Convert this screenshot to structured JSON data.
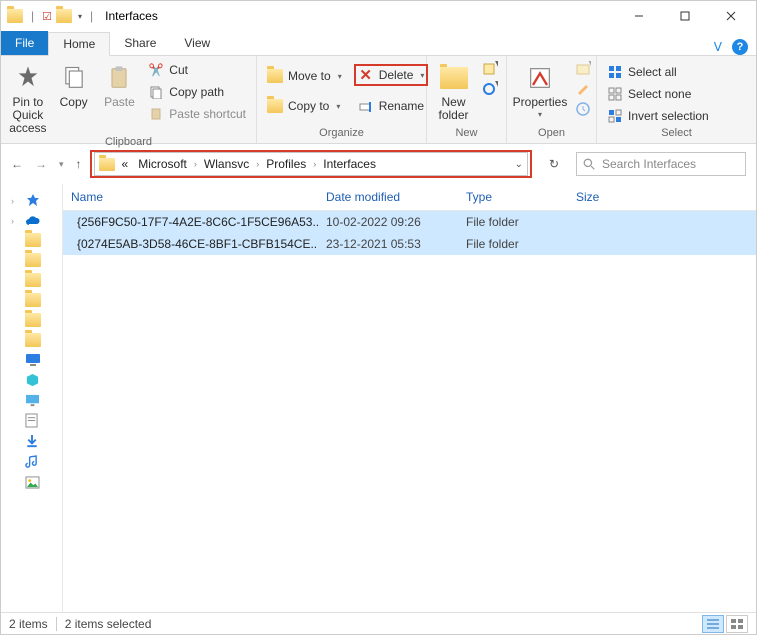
{
  "window": {
    "title": "Interfaces"
  },
  "tabs": {
    "file": "File",
    "home": "Home",
    "share": "Share",
    "view": "View"
  },
  "ribbon": {
    "clipboard": {
      "label": "Clipboard",
      "pin": "Pin to Quick access",
      "copy": "Copy",
      "paste": "Paste",
      "cut": "Cut",
      "copy_path": "Copy path",
      "paste_shortcut": "Paste shortcut"
    },
    "organize": {
      "label": "Organize",
      "move_to": "Move to",
      "copy_to": "Copy to",
      "delete": "Delete",
      "rename": "Rename"
    },
    "new": {
      "label": "New",
      "new_folder": "New folder"
    },
    "open": {
      "label": "Open",
      "properties": "Properties"
    },
    "select": {
      "label": "Select",
      "all": "Select all",
      "none": "Select none",
      "invert": "Invert selection"
    }
  },
  "breadcrumb": {
    "prefix": "«",
    "parts": [
      "Microsoft",
      "Wlansvc",
      "Profiles",
      "Interfaces"
    ]
  },
  "search": {
    "placeholder": "Search Interfaces"
  },
  "columns": {
    "name": "Name",
    "date": "Date modified",
    "type": "Type",
    "size": "Size"
  },
  "rows": [
    {
      "name": "{256F9C50-17F7-4A2E-8C6C-1F5CE96A53...",
      "date": "10-02-2022 09:26",
      "type": "File folder",
      "size": ""
    },
    {
      "name": "{0274E5AB-3D58-46CE-8BF1-CBFB154CE...",
      "date": "23-12-2021 05:53",
      "type": "File folder",
      "size": ""
    }
  ],
  "status": {
    "items": "2 items",
    "selected": "2 items selected"
  }
}
